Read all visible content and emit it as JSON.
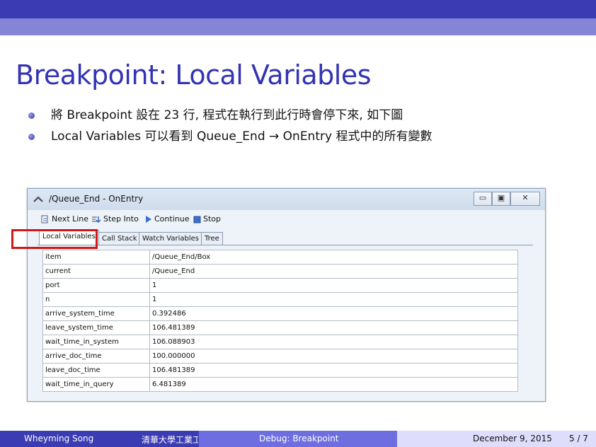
{
  "slide": {
    "title": "Breakpoint: Local Variables",
    "bullets": [
      "將 Breakpoint 設在 23 行, 程式在執行到此行時會停下來, 如下圖",
      "Local Variables 可以看到 Queue_End → OnEntry 程式中的所有變數"
    ]
  },
  "window": {
    "title": "/Queue_End - OnEntry",
    "controls": {
      "minimize": "▭",
      "maximize": "▣",
      "close": "✕"
    },
    "toolbar": {
      "next_line": "Next Line",
      "step_into": "Step Into",
      "continue": "Continue",
      "stop": "Stop"
    },
    "tabs": [
      "Local Variables",
      "Call Stack",
      "Watch Variables",
      "Tree"
    ],
    "variables": [
      {
        "name": "item",
        "value": "/Queue_End/Box"
      },
      {
        "name": "current",
        "value": "/Queue_End"
      },
      {
        "name": "port",
        "value": "1"
      },
      {
        "name": "n",
        "value": "1"
      },
      {
        "name": "arrive_system_time",
        "value": "0.392486"
      },
      {
        "name": "leave_system_time",
        "value": "106.481389"
      },
      {
        "name": "wait_time_in_system",
        "value": "106.088903"
      },
      {
        "name": "arrive_doc_time",
        "value": "100.000000"
      },
      {
        "name": "leave_doc_time",
        "value": "106.481389"
      },
      {
        "name": "wait_time_in_query",
        "value": "6.481389"
      }
    ]
  },
  "footer": {
    "author": "Wheyming Song",
    "institution": "清華大學工業工程",
    "section": "Debug: Breakpoint",
    "date": "December 9, 2015",
    "page": "5 / 7"
  },
  "colors": {
    "header_dark": "#3b3bb3",
    "header_light": "#8585d8",
    "title": "#3333b3",
    "highlight": "#d01818"
  }
}
